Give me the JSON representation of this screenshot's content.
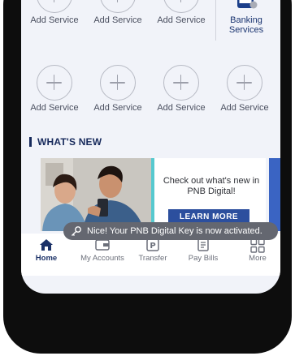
{
  "services": {
    "row1": [
      {
        "label": "Add Service",
        "icon": "plus-icon"
      },
      {
        "label": "Add Service",
        "icon": "plus-icon"
      },
      {
        "label": "Add Service",
        "icon": "plus-icon"
      },
      {
        "label": "Banking Services",
        "icon": "bank-phone-icon"
      }
    ],
    "row2": [
      {
        "label": "Add Service",
        "icon": "plus-icon"
      },
      {
        "label": "Add Service",
        "icon": "plus-icon"
      },
      {
        "label": "Add Service",
        "icon": "plus-icon"
      },
      {
        "label": "Add Service",
        "icon": "plus-icon"
      }
    ]
  },
  "whats_new": {
    "title": "WHAT'S NEW",
    "banner": {
      "text": "Check out what's new in PNB Digital!",
      "cta": "LEARN MORE"
    }
  },
  "toast": {
    "message": "Nice! Your PNB Digital Key is now activated.",
    "icon": "key-icon"
  },
  "nav": {
    "items": [
      {
        "label": "Home",
        "icon": "home-icon",
        "active": true
      },
      {
        "label": "My Accounts",
        "icon": "accounts-icon",
        "active": false
      },
      {
        "label": "Transfer",
        "icon": "transfer-icon",
        "active": false
      },
      {
        "label": "Pay Bills",
        "icon": "bills-icon",
        "active": false
      },
      {
        "label": "More",
        "icon": "grid-icon",
        "active": false
      }
    ]
  },
  "colors": {
    "brand_navy": "#16295b",
    "accent_teal": "#57c9cf",
    "button_blue": "#2c4f9e",
    "screen_bg": "#f1f3f9"
  }
}
